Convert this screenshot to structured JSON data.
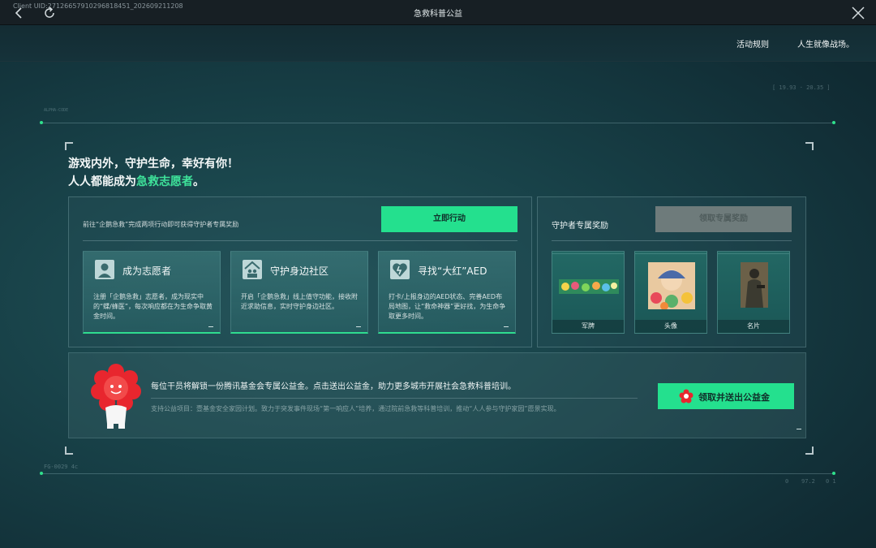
{
  "window": {
    "uid": "Client UID:2712665791029681­8451_202609211208",
    "title": "急救科普公益"
  },
  "nav": {
    "rules_link": "活动规则",
    "slogan_link": "人生就像战场。"
  },
  "headline": {
    "line1": "游戏内外，守护生命，幸好有你！",
    "line2_prefix": "人人都能成为",
    "line2_highlight": "急救志愿者",
    "line2_suffix": "。"
  },
  "actions_panel": {
    "note": "前往“企鹅急救”完成两项行动即可获得守护者专属奖励",
    "act_button": "立即行动",
    "tasks": [
      {
        "icon": "volunteer-avatar-icon",
        "title": "成为志愿者",
        "desc": "注册「企鹅急救」志愿者，成为现实中的“蝶/蜂医”，每次响应都在为生命争取黄金时间。"
      },
      {
        "icon": "community-house-icon",
        "title": "守护身边社区",
        "desc": "开启「企鹅急救」线上值守功能，接收附近求助信息，实时守护身边社区。"
      },
      {
        "icon": "aed-heart-icon",
        "title": "寻找“大红”AED",
        "desc": "打卡/上报身边的AED状态、完善AED布局地图，让“救命神器”更好找，为生命争取更多时间。"
      }
    ]
  },
  "rewards_panel": {
    "title": "守护者专属奖励",
    "claim_button": "领取专属奖励",
    "items": [
      {
        "label": "军牌"
      },
      {
        "label": "头像"
      },
      {
        "label": "名片"
      }
    ]
  },
  "donation": {
    "text": "每位干员将解锁一份腾讯基金会专属公益金。点击送出公益金，助力更多城市开展社会急救科普培训。",
    "support": "支持公益项目：壹基金安全家园计划。致力于突发事件现场“第一响应人”培养，通过院前急救等科普培训，推动“人人参与守护家园”愿景实现。",
    "button": "领取并送出公益金"
  },
  "deco": {
    "coords": "[ 19.93 · 20.35 ]",
    "left_tag": "ALPHA-CODE",
    "bottom_left": "FG-0029 4c",
    "bottom_right_a": "0",
    "bottom_right_b": "97.2",
    "bottom_right_c": "0 1"
  },
  "colors": {
    "accent": "#24e08e",
    "highlight": "#3ee29a",
    "disabled": "#6e7b7b"
  }
}
